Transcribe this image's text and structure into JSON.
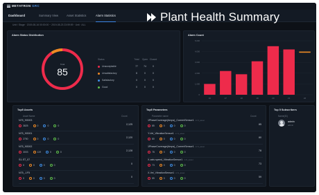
{
  "app": {
    "brand": "METATRON",
    "brand_accent": "GRC"
  },
  "nav": {
    "dashboard": "Dashboard",
    "tabs": [
      "Summary View",
      "Asset Statistics",
      "Alarm Statistics"
    ]
  },
  "breadcrumb": "Unit / Stage  ·  2019-08-16 00:00:00 ~ 2019-08-23 23:59:59  ·  Unit  ·  ALL",
  "banner": "Plant Health Summary",
  "colors": {
    "accent": "#3d86e6",
    "red": "#ee2b4b",
    "orange": "#f08a24",
    "blue": "#3f8fe8",
    "green": "#5fbf4a"
  },
  "alarm_status": {
    "title": "Alarm Status Distribution",
    "gauge_label": "Total",
    "score": "85",
    "headers": [
      "Status",
      "Total",
      "Open",
      "Closed"
    ],
    "rows": [
      {
        "label": "Unacceptable",
        "color": "#ee2b4b",
        "total": "77",
        "open": "74",
        "closed": "0"
      },
      {
        "label": "Unsatisfactory",
        "color": "#f08a24",
        "total": "8",
        "open": "0",
        "closed": "0"
      },
      {
        "label": "Satisfactory",
        "color": "#3f8fe8",
        "total": "0",
        "open": "0",
        "closed": "0"
      },
      {
        "label": "Good",
        "color": "#5fbf4a",
        "total": "0",
        "open": "0",
        "closed": "0"
      }
    ]
  },
  "alarm_count": {
    "title": "Alarm Count",
    "chart_data": {
      "type": "bar",
      "categories": [
        "16",
        "17",
        "18",
        "19",
        "20",
        "21",
        "22"
      ],
      "series": [
        {
          "values": [
            1000,
            2200,
            1900,
            3100,
            4500,
            4200,
            0
          ]
        },
        {
          "values": [
            0,
            0,
            0,
            0,
            0,
            0,
            4000
          ]
        }
      ],
      "ylim": [
        0,
        5000
      ],
      "yticks": [
        "5,000",
        "4,000",
        "3,000",
        "2,000",
        "1,000",
        "0"
      ],
      "grid": true
    }
  },
  "top_assets": {
    "title": "Top5 Assets",
    "col_name": "Asset Name",
    "col_count": "Count",
    "rows": [
      {
        "name": "N75_9G003",
        "chips": [
          "3825",
          "0",
          "0",
          "0"
        ],
        "count": "2,125"
      },
      {
        "name": "N75_9G001",
        "chips": [
          "2750",
          "0",
          "0",
          "0"
        ],
        "count": "2,120"
      },
      {
        "name": "N75_9G002",
        "chips": [
          "3003",
          "119",
          "0",
          "0"
        ],
        "count": "2,128"
      },
      {
        "name": "S1-ST_07",
        "chips": [
          "0",
          "0",
          "0",
          "0"
        ],
        "count": "0"
      },
      {
        "name": "N75_-1F5",
        "chips": [
          "0",
          "0",
          "0",
          "0"
        ],
        "count": "0"
      }
    ]
  },
  "top_parameters": {
    "title": "Top5 Parameters",
    "col_name": "Parameter name",
    "col_count": "Count",
    "rows": [
      {
        "name": "1PhaseCoverage(Amps)_CurrentSensor1",
        "sub": "in N_asset",
        "chips": [
          "85",
          "0",
          "0",
          "0"
        ],
        "count": "85"
      },
      {
        "name": "Y-Vel_VibrationSensor1",
        "sub": "in N_asset",
        "chips": [
          "80",
          "0",
          "0",
          "0"
        ],
        "count": "80"
      },
      {
        "name": "1PhaseCoverage(Amps)_CurrentSensor1",
        "sub": "in N_asset",
        "chips": [
          "78",
          "0",
          "0",
          "0"
        ],
        "count": "78"
      },
      {
        "name": "X-axis speed_VibrationSensor1",
        "sub": "in N_asset",
        "chips": [
          "73",
          "0",
          "0",
          "0"
        ],
        "count": "73"
      },
      {
        "name": "X-Vel_VibrationSensor1",
        "sub": "in N_asset",
        "chips": [
          "59",
          "0",
          "0",
          "0"
        ],
        "count": "59"
      }
    ]
  },
  "top_users": {
    "title": "Top 5 Subscribers",
    "col_name": "Name(ID)",
    "user": {
      "name": "admin",
      "sub": "admin"
    }
  }
}
